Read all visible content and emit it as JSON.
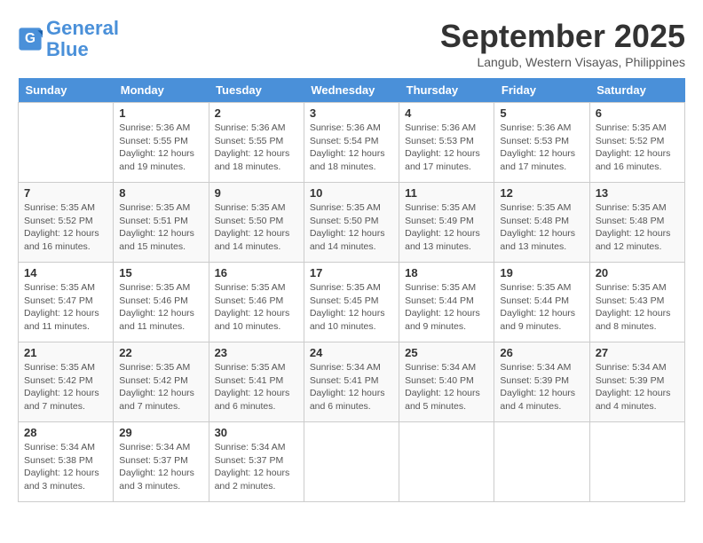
{
  "logo": {
    "line1": "General",
    "line2": "Blue"
  },
  "title": "September 2025",
  "location": "Langub, Western Visayas, Philippines",
  "weekdays": [
    "Sunday",
    "Monday",
    "Tuesday",
    "Wednesday",
    "Thursday",
    "Friday",
    "Saturday"
  ],
  "weeks": [
    [
      {
        "day": "",
        "info": ""
      },
      {
        "day": "1",
        "info": "Sunrise: 5:36 AM\nSunset: 5:55 PM\nDaylight: 12 hours\nand 19 minutes."
      },
      {
        "day": "2",
        "info": "Sunrise: 5:36 AM\nSunset: 5:55 PM\nDaylight: 12 hours\nand 18 minutes."
      },
      {
        "day": "3",
        "info": "Sunrise: 5:36 AM\nSunset: 5:54 PM\nDaylight: 12 hours\nand 18 minutes."
      },
      {
        "day": "4",
        "info": "Sunrise: 5:36 AM\nSunset: 5:53 PM\nDaylight: 12 hours\nand 17 minutes."
      },
      {
        "day": "5",
        "info": "Sunrise: 5:36 AM\nSunset: 5:53 PM\nDaylight: 12 hours\nand 17 minutes."
      },
      {
        "day": "6",
        "info": "Sunrise: 5:35 AM\nSunset: 5:52 PM\nDaylight: 12 hours\nand 16 minutes."
      }
    ],
    [
      {
        "day": "7",
        "info": "Sunrise: 5:35 AM\nSunset: 5:52 PM\nDaylight: 12 hours\nand 16 minutes."
      },
      {
        "day": "8",
        "info": "Sunrise: 5:35 AM\nSunset: 5:51 PM\nDaylight: 12 hours\nand 15 minutes."
      },
      {
        "day": "9",
        "info": "Sunrise: 5:35 AM\nSunset: 5:50 PM\nDaylight: 12 hours\nand 14 minutes."
      },
      {
        "day": "10",
        "info": "Sunrise: 5:35 AM\nSunset: 5:50 PM\nDaylight: 12 hours\nand 14 minutes."
      },
      {
        "day": "11",
        "info": "Sunrise: 5:35 AM\nSunset: 5:49 PM\nDaylight: 12 hours\nand 13 minutes."
      },
      {
        "day": "12",
        "info": "Sunrise: 5:35 AM\nSunset: 5:48 PM\nDaylight: 12 hours\nand 13 minutes."
      },
      {
        "day": "13",
        "info": "Sunrise: 5:35 AM\nSunset: 5:48 PM\nDaylight: 12 hours\nand 12 minutes."
      }
    ],
    [
      {
        "day": "14",
        "info": "Sunrise: 5:35 AM\nSunset: 5:47 PM\nDaylight: 12 hours\nand 11 minutes."
      },
      {
        "day": "15",
        "info": "Sunrise: 5:35 AM\nSunset: 5:46 PM\nDaylight: 12 hours\nand 11 minutes."
      },
      {
        "day": "16",
        "info": "Sunrise: 5:35 AM\nSunset: 5:46 PM\nDaylight: 12 hours\nand 10 minutes."
      },
      {
        "day": "17",
        "info": "Sunrise: 5:35 AM\nSunset: 5:45 PM\nDaylight: 12 hours\nand 10 minutes."
      },
      {
        "day": "18",
        "info": "Sunrise: 5:35 AM\nSunset: 5:44 PM\nDaylight: 12 hours\nand 9 minutes."
      },
      {
        "day": "19",
        "info": "Sunrise: 5:35 AM\nSunset: 5:44 PM\nDaylight: 12 hours\nand 9 minutes."
      },
      {
        "day": "20",
        "info": "Sunrise: 5:35 AM\nSunset: 5:43 PM\nDaylight: 12 hours\nand 8 minutes."
      }
    ],
    [
      {
        "day": "21",
        "info": "Sunrise: 5:35 AM\nSunset: 5:42 PM\nDaylight: 12 hours\nand 7 minutes."
      },
      {
        "day": "22",
        "info": "Sunrise: 5:35 AM\nSunset: 5:42 PM\nDaylight: 12 hours\nand 7 minutes."
      },
      {
        "day": "23",
        "info": "Sunrise: 5:35 AM\nSunset: 5:41 PM\nDaylight: 12 hours\nand 6 minutes."
      },
      {
        "day": "24",
        "info": "Sunrise: 5:34 AM\nSunset: 5:41 PM\nDaylight: 12 hours\nand 6 minutes."
      },
      {
        "day": "25",
        "info": "Sunrise: 5:34 AM\nSunset: 5:40 PM\nDaylight: 12 hours\nand 5 minutes."
      },
      {
        "day": "26",
        "info": "Sunrise: 5:34 AM\nSunset: 5:39 PM\nDaylight: 12 hours\nand 4 minutes."
      },
      {
        "day": "27",
        "info": "Sunrise: 5:34 AM\nSunset: 5:39 PM\nDaylight: 12 hours\nand 4 minutes."
      }
    ],
    [
      {
        "day": "28",
        "info": "Sunrise: 5:34 AM\nSunset: 5:38 PM\nDaylight: 12 hours\nand 3 minutes."
      },
      {
        "day": "29",
        "info": "Sunrise: 5:34 AM\nSunset: 5:37 PM\nDaylight: 12 hours\nand 3 minutes."
      },
      {
        "day": "30",
        "info": "Sunrise: 5:34 AM\nSunset: 5:37 PM\nDaylight: 12 hours\nand 2 minutes."
      },
      {
        "day": "",
        "info": ""
      },
      {
        "day": "",
        "info": ""
      },
      {
        "day": "",
        "info": ""
      },
      {
        "day": "",
        "info": ""
      }
    ]
  ]
}
